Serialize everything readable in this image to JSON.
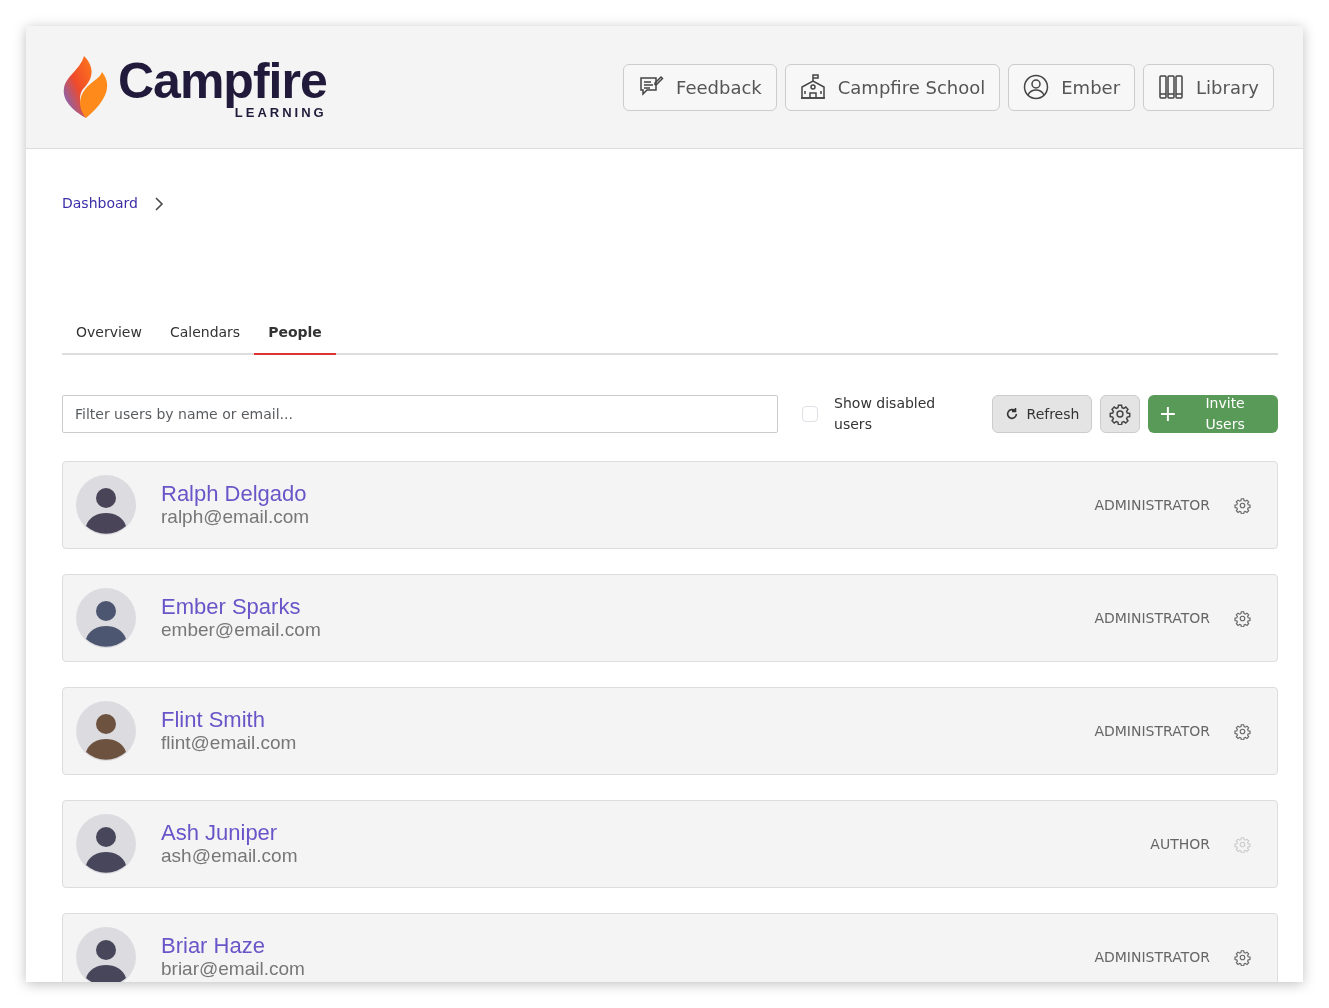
{
  "header": {
    "logo": {
      "name": "Campfire",
      "tagline": "LEARNING"
    },
    "buttons": [
      {
        "kind": "feedback",
        "label": "Feedback"
      },
      {
        "kind": "school",
        "label": "Campfire School"
      },
      {
        "kind": "user",
        "label": "Ember"
      },
      {
        "kind": "library",
        "label": "Library"
      }
    ]
  },
  "breadcrumb": [
    {
      "label": "Dashboard"
    }
  ],
  "tabs": [
    {
      "label": "Overview",
      "selected": false
    },
    {
      "label": "Calendars",
      "selected": false
    },
    {
      "label": "People",
      "selected": true
    }
  ],
  "toolbar": {
    "filter": {
      "placeholder": "Filter users by name or email..."
    },
    "show_disabled": {
      "label": "Show disabled users",
      "checked": false
    },
    "refresh": "Refresh",
    "invite": "Invite Users"
  },
  "users": [
    {
      "name": "Ralph Delgado",
      "email": "ralph@email.com",
      "role": "ADMINISTRATOR",
      "color": "#4a4458",
      "settings_disabled": false
    },
    {
      "name": "Ember Sparks",
      "email": "ember@email.com",
      "role": "ADMINISTRATOR",
      "color": "#4c5670",
      "settings_disabled": false
    },
    {
      "name": "Flint Smith",
      "email": "flint@email.com",
      "role": "ADMINISTRATOR",
      "color": "#6e5240",
      "settings_disabled": false
    },
    {
      "name": "Ash Juniper",
      "email": "ash@email.com",
      "role": "AUTHOR",
      "color": "#48465a",
      "settings_disabled": true
    },
    {
      "name": "Briar Haze",
      "email": "briar@email.com",
      "role": "ADMINISTRATOR",
      "color": "#48465a",
      "settings_disabled": false
    }
  ]
}
